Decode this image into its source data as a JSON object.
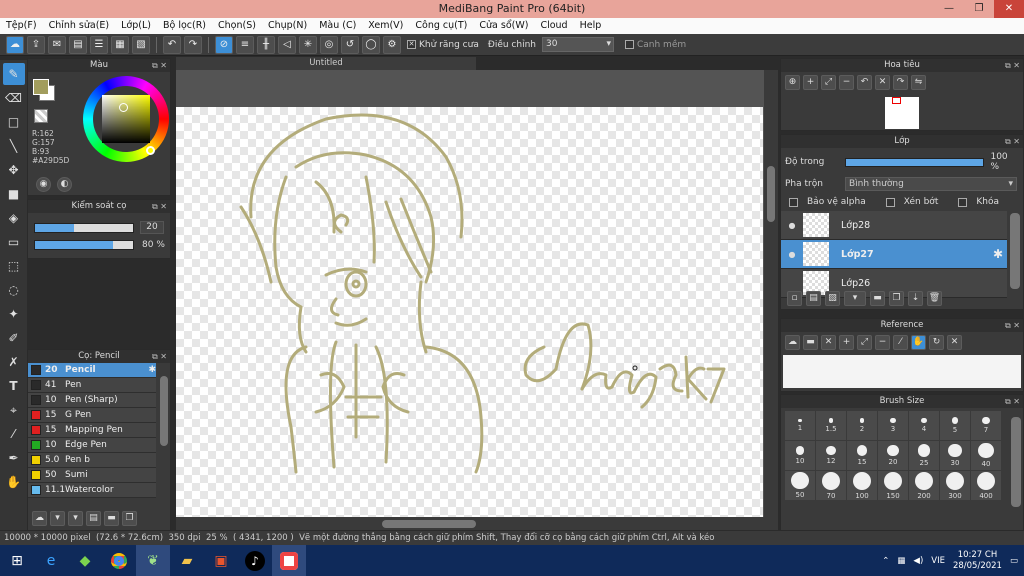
{
  "window": {
    "title": "MediBang Paint Pro (64bit)",
    "min": "—",
    "max": "❐",
    "close": "✕"
  },
  "menu": [
    "Tệp(F)",
    "Chỉnh sửa(E)",
    "Lớp(L)",
    "Bộ lọc(R)",
    "Chọn(S)",
    "Chụp(N)",
    "Màu (C)",
    "Xem(V)",
    "Công cụ(T)",
    "Cửa sổ(W)",
    "Cloud",
    "Help"
  ],
  "toolbar": {
    "antialias_label": "Khử răng cưa",
    "antialias_checked": true,
    "adjust_label": "Điều chỉnh",
    "adjust_value": "30",
    "smooth_label": "Canh mềm",
    "smooth_checked": false
  },
  "color_panel": {
    "title": "Màu",
    "r": "R:162",
    "g": "G:157",
    "b": "B:93",
    "hex": "#A29D5D",
    "primary_color": "#A29D5D",
    "secondary_color": "#ffffff"
  },
  "brush_control": {
    "title": "Kiểm soát cọ",
    "size_value": "20",
    "size_fraction": 0.4,
    "opacity_value": "80 %",
    "opacity_fraction": 0.8
  },
  "brush_list": {
    "title": "Cọ: Pencil",
    "items": [
      {
        "size": "20",
        "name": "Pencil",
        "color": "#2a2a2a",
        "selected": true
      },
      {
        "size": "41",
        "name": "Pen",
        "color": "#2a2a2a",
        "selected": false
      },
      {
        "size": "10",
        "name": "Pen (Sharp)",
        "color": "#2a2a2a",
        "selected": false
      },
      {
        "size": "15",
        "name": "G Pen",
        "color": "#e02020",
        "selected": false
      },
      {
        "size": "15",
        "name": "Mapping Pen",
        "color": "#e02020",
        "selected": false
      },
      {
        "size": "10",
        "name": "Edge Pen",
        "color": "#22aa22",
        "selected": false
      },
      {
        "size": "5.0",
        "name": "Pen b",
        "color": "#f0d000",
        "selected": false
      },
      {
        "size": "50",
        "name": "Sumi",
        "color": "#f0d000",
        "selected": false
      },
      {
        "size": "11.1",
        "name": "Watercolor",
        "color": "#66bbee",
        "selected": false
      }
    ]
  },
  "document": {
    "tab_title": "Untitled"
  },
  "navigator": {
    "title": "Hoa tiêu"
  },
  "layer_panel": {
    "title": "Lớp",
    "opacity_label": "Độ trong",
    "opacity_value": "100 %",
    "opacity_fraction": 1.0,
    "blend_label": "Pha trộn",
    "blend_value": "Bình thường",
    "protect_alpha": "Bảo vệ alpha",
    "clipping": "Xén bớt",
    "lock": "Khóa",
    "layers": [
      {
        "name": "Lớp28",
        "selected": false
      },
      {
        "name": "Lớp27",
        "selected": true
      },
      {
        "name": "Lớp26",
        "selected": false
      }
    ]
  },
  "reference_panel": {
    "title": "Reference"
  },
  "brush_size_panel": {
    "title": "Brush Size",
    "sizes": [
      "1",
      "1.5",
      "2",
      "3",
      "4",
      "5",
      "7",
      "10",
      "12",
      "15",
      "20",
      "25",
      "30",
      "40",
      "50",
      "70",
      "100",
      "150",
      "200",
      "300",
      "400"
    ]
  },
  "status": {
    "canvas_size": "10000 * 10000 pixel",
    "physical_size": "(72.6 * 72.6cm)",
    "dpi": "350 dpi",
    "zoom": "25 %",
    "cursor": "( 4341, 1200 )",
    "hint": "Vẽ một đường thẳng bằng cách giữ phím Shift, Thay đổi cỡ cọ bằng cách giữ phím Ctrl, Alt và kéo"
  },
  "taskbar": {
    "lang": "VIE",
    "time": "10:27 CH",
    "date": "28/05/2021"
  },
  "drawing": {
    "stroke_color": "#B3AC7A",
    "signature_text": "chug2k7"
  }
}
